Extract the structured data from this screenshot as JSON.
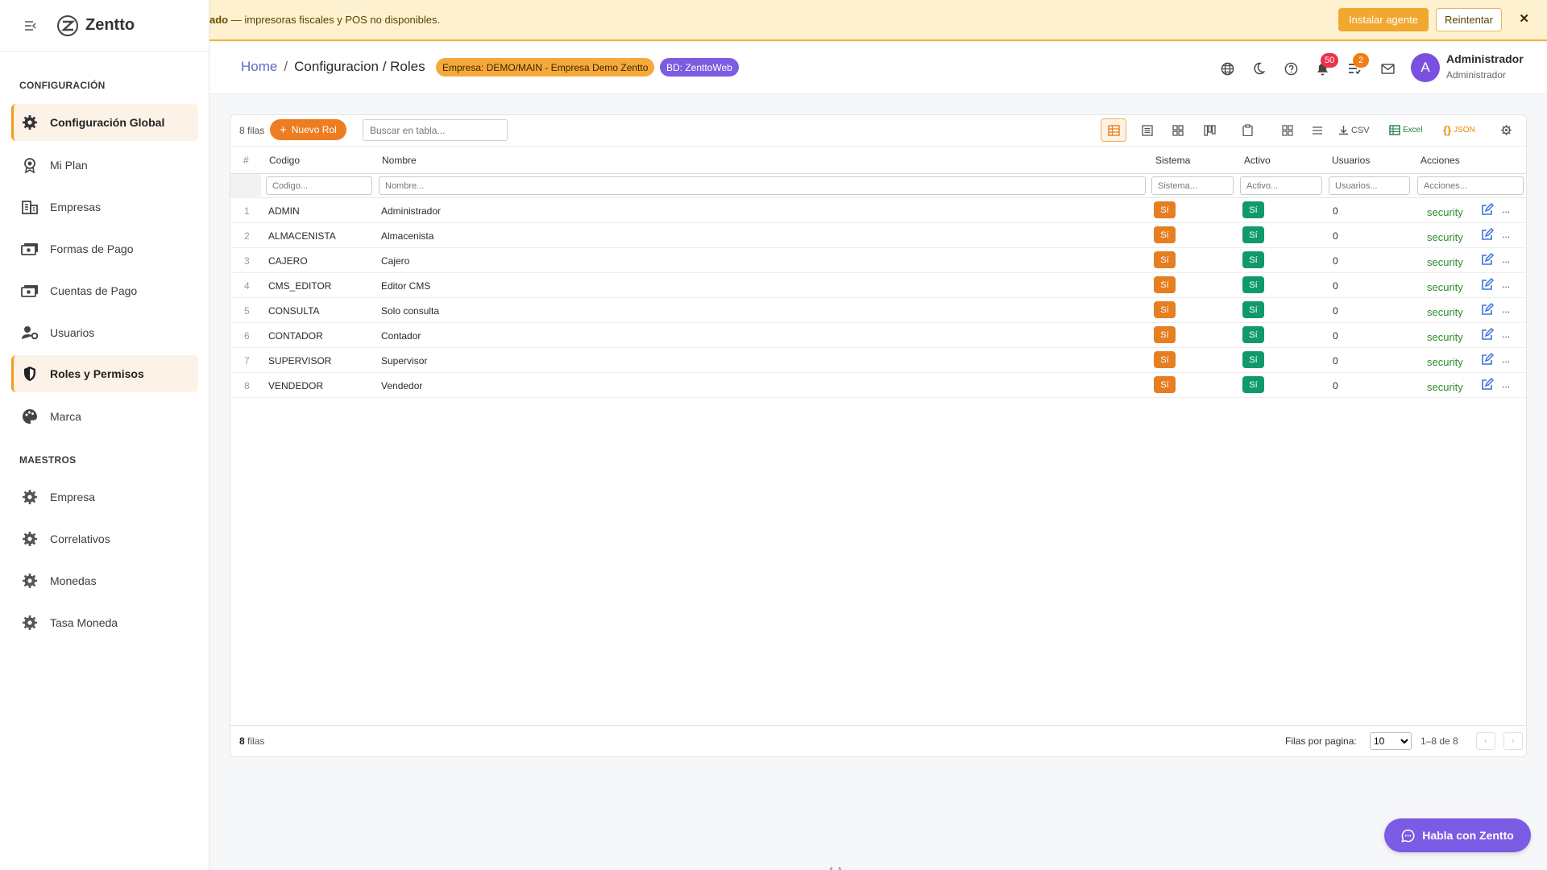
{
  "sidebar": {
    "logo_text": "Zentto",
    "sections": [
      {
        "title": "CONFIGURACIÓN",
        "items": [
          {
            "label": "Configuración Global",
            "icon": "gear-icon"
          },
          {
            "label": "Mi Plan",
            "icon": "award-icon"
          },
          {
            "label": "Empresas",
            "icon": "building-icon"
          },
          {
            "label": "Formas de Pago",
            "icon": "payment-icon"
          },
          {
            "label": "Cuentas de Pago",
            "icon": "payment-icon"
          },
          {
            "label": "Usuarios",
            "icon": "user-gear-icon"
          },
          {
            "label": "Roles y Permisos",
            "icon": "shield-icon"
          },
          {
            "label": "Marca",
            "icon": "palette-icon"
          }
        ]
      },
      {
        "title": "MAESTROS",
        "items": [
          {
            "label": "Empresa",
            "icon": "gear-icon"
          },
          {
            "label": "Correlativos",
            "icon": "gear-icon"
          },
          {
            "label": "Monedas",
            "icon": "gear-icon"
          },
          {
            "label": "Tasa Moneda",
            "icon": "gear-icon"
          }
        ]
      }
    ]
  },
  "banner": {
    "bold": "ado",
    "text": " — impresoras fiscales y POS no disponibles.",
    "install_label": "Instalar agente",
    "retry_label": "Reintentar",
    "close_label": "✕"
  },
  "header": {
    "breadcrumb_home": "Home",
    "breadcrumb_sep": "/",
    "breadcrumb_current": "Configuracion / Roles",
    "empresa_chip": "Empresa: DEMO/MAIN - Empresa Demo Zentto",
    "bd_chip": "BD: ZenttoWeb",
    "notifications_count": "50",
    "tasks_count": "2",
    "user_initial": "A",
    "user_name": "Administrador",
    "user_role": "Administrador"
  },
  "grid": {
    "rows_label": "8 filas",
    "new_button": "Nuevo Rol",
    "search_placeholder": "Buscar en tabla...",
    "tools": {
      "csv": "CSV",
      "excel": "Excel",
      "json": "JSON"
    },
    "columns": {
      "num": "#",
      "codigo": "Codigo",
      "nombre": "Nombre",
      "sistema": "Sistema",
      "activo": "Activo",
      "usuarios": "Usuarios",
      "acciones": "Acciones"
    },
    "filters": {
      "codigo": "Codigo...",
      "nombre": "Nombre...",
      "sistema": "Sistema...",
      "activo": "Activo...",
      "usuarios": "Usuarios...",
      "acciones": "Acciones..."
    },
    "rows": [
      {
        "n": "1",
        "codigo": "ADMIN",
        "nombre": "Administrador",
        "sistema": "Sí",
        "activo": "Sí",
        "usuarios": "0",
        "action": "security",
        "more": "..."
      },
      {
        "n": "2",
        "codigo": "ALMACENISTA",
        "nombre": "Almacenista",
        "sistema": "Sí",
        "activo": "Sí",
        "usuarios": "0",
        "action": "security",
        "more": "..."
      },
      {
        "n": "3",
        "codigo": "CAJERO",
        "nombre": "Cajero",
        "sistema": "Sí",
        "activo": "Sí",
        "usuarios": "0",
        "action": "security",
        "more": "..."
      },
      {
        "n": "4",
        "codigo": "CMS_EDITOR",
        "nombre": "Editor CMS",
        "sistema": "Sí",
        "activo": "Sí",
        "usuarios": "0",
        "action": "security",
        "more": "..."
      },
      {
        "n": "5",
        "codigo": "CONSULTA",
        "nombre": "Solo consulta",
        "sistema": "Sí",
        "activo": "Sí",
        "usuarios": "0",
        "action": "security",
        "more": "..."
      },
      {
        "n": "6",
        "codigo": "CONTADOR",
        "nombre": "Contador",
        "sistema": "Sí",
        "activo": "Sí",
        "usuarios": "0",
        "action": "security",
        "more": "..."
      },
      {
        "n": "7",
        "codigo": "SUPERVISOR",
        "nombre": "Supervisor",
        "sistema": "Sí",
        "activo": "Sí",
        "usuarios": "0",
        "action": "security",
        "more": "..."
      },
      {
        "n": "8",
        "codigo": "VENDEDOR",
        "nombre": "Vendedor",
        "sistema": "Sí",
        "activo": "Sí",
        "usuarios": "0",
        "action": "security",
        "more": "..."
      }
    ],
    "footer": {
      "count": "8",
      "count_suffix": " filas",
      "per_page_label": "Filas por pagina:",
      "per_page_value": "10",
      "range": "1–8 de 8",
      "prev": "‹",
      "next": "›"
    }
  },
  "chat": {
    "label": "Habla con Zentto"
  },
  "colors": {
    "accent": "#ee7d22",
    "success": "#109a6c",
    "brand_purple": "#7a5be3",
    "banner_bg": "#fdf1cf"
  }
}
